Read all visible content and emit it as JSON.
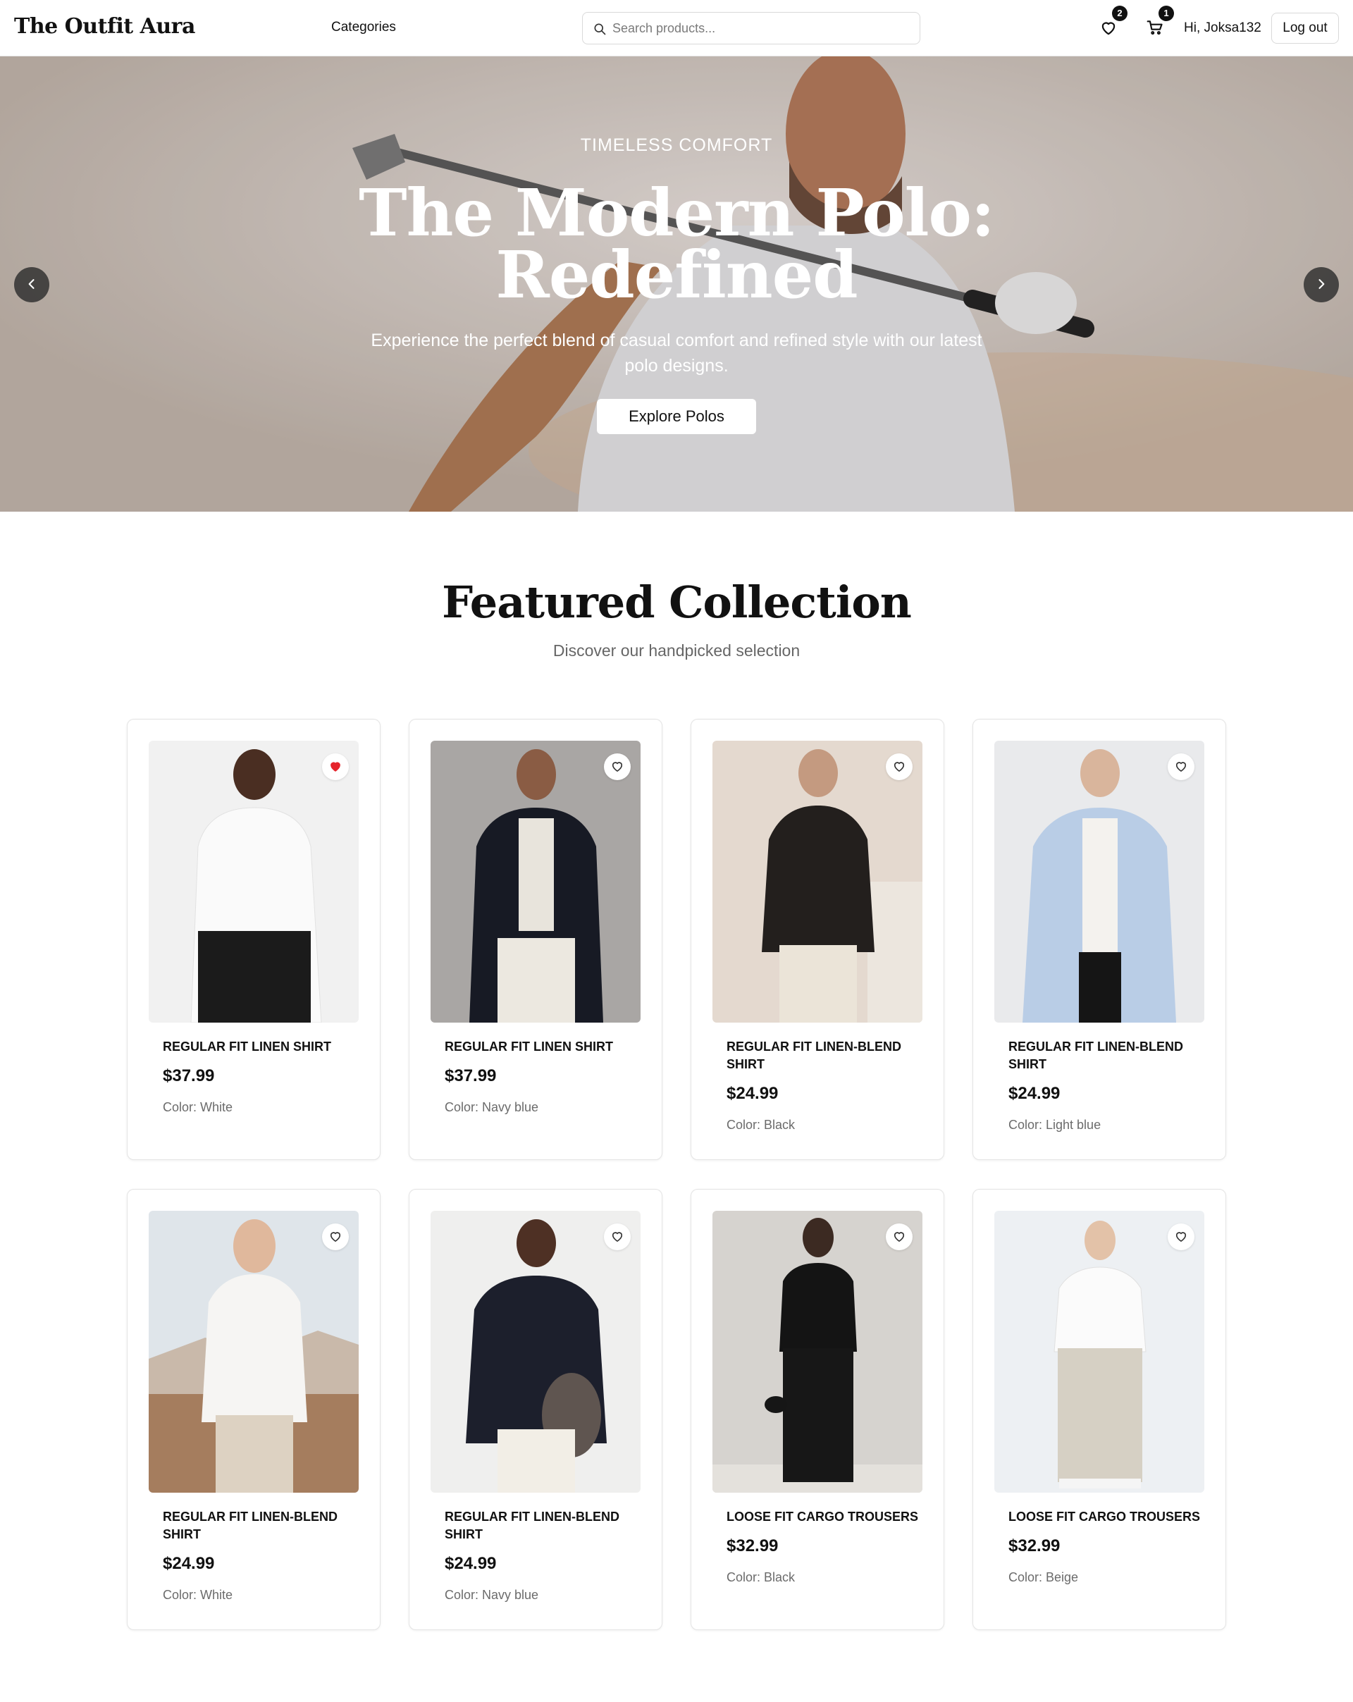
{
  "header": {
    "logo": "The Outfit Aura",
    "categories_label": "Categories",
    "search_placeholder": "Search products...",
    "wishlist_count": "2",
    "cart_count": "1",
    "greeting": "Hi, Joksa132",
    "logout_label": "Log out",
    "icons": [
      "search-icon",
      "heart-icon",
      "cart-icon"
    ]
  },
  "hero": {
    "kicker": "TIMELESS COMFORT",
    "title": "The Modern Polo: Redefined",
    "subtitle": "Experience the perfect blend of casual comfort and refined style with our latest polo designs.",
    "cta_label": "Explore Polos",
    "icons": [
      "chevron-left-icon",
      "chevron-right-icon"
    ]
  },
  "featured": {
    "title": "Featured Collection",
    "subtitle": "Discover our handpicked selection",
    "products": [
      {
        "name": "REGULAR FIT LINEN SHIRT",
        "price": "$37.99",
        "color": "Color: White",
        "favorited": true
      },
      {
        "name": "REGULAR FIT LINEN SHIRT",
        "price": "$37.99",
        "color": "Color: Navy blue",
        "favorited": false
      },
      {
        "name": "REGULAR FIT LINEN-BLEND SHIRT",
        "price": "$24.99",
        "color": "Color: Black",
        "favorited": false
      },
      {
        "name": "REGULAR FIT LINEN-BLEND SHIRT",
        "price": "$24.99",
        "color": "Color: Light blue",
        "favorited": false
      },
      {
        "name": "REGULAR FIT LINEN-BLEND SHIRT",
        "price": "$24.99",
        "color": "Color: White",
        "favorited": false
      },
      {
        "name": "REGULAR FIT LINEN-BLEND SHIRT",
        "price": "$24.99",
        "color": "Color: Navy blue",
        "favorited": false
      },
      {
        "name": "LOOSE FIT CARGO TROUSERS",
        "price": "$32.99",
        "color": "Color: Black",
        "favorited": false
      },
      {
        "name": "LOOSE FIT CARGO TROUSERS",
        "price": "$32.99",
        "color": "Color: Beige",
        "favorited": false
      }
    ]
  },
  "colors": {
    "text": "#111111",
    "muted": "#666666",
    "favorite_active": "#e5232b",
    "badge_bg": "#111111"
  }
}
